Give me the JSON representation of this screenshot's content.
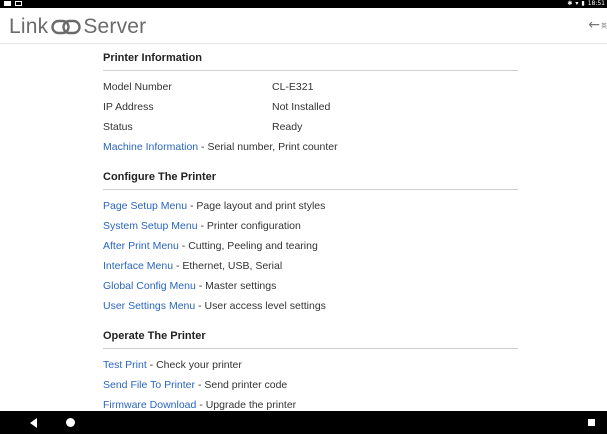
{
  "status_bar": {
    "bluetooth_icon": "bluetooth-icon",
    "wifi_icon": "wifi-icon",
    "battery_icon": "battery-icon",
    "time": "18:51"
  },
  "app": {
    "title_left": "Link",
    "title_right": "Server",
    "back_icon": "arrow-left-icon",
    "back_sub": "英"
  },
  "printer_info": {
    "title": "Printer Information",
    "rows": [
      {
        "label": "Model Number",
        "value": "CL-E321"
      },
      {
        "label": "IP Address",
        "value": "Not Installed"
      },
      {
        "label": "Status",
        "value": "Ready"
      }
    ],
    "machine_link": {
      "link": "Machine Information",
      "desc": " - Serial number, Print counter"
    }
  },
  "configure": {
    "title": "Configure The Printer",
    "items": [
      {
        "link": "Page Setup Menu",
        "desc": " - Page layout and print styles"
      },
      {
        "link": "System Setup Menu",
        "desc": " - Printer configuration"
      },
      {
        "link": "After Print Menu",
        "desc": " - Cutting, Peeling and tearing"
      },
      {
        "link": "Interface Menu",
        "desc": " - Ethernet, USB, Serial"
      },
      {
        "link": "Global Config Menu",
        "desc": " - Master settings"
      },
      {
        "link": "User Settings Menu",
        "desc": " - User access level settings"
      }
    ]
  },
  "operate": {
    "title": "Operate The Printer",
    "items": [
      {
        "link": "Test Print",
        "desc": " - Check your printer"
      },
      {
        "link": "Send File To Printer",
        "desc": " - Send printer code"
      },
      {
        "link": "Firmware Download",
        "desc": " - Upgrade the printer"
      }
    ]
  },
  "nav": {
    "back_icon": "nav-back-icon",
    "home_icon": "nav-home-icon",
    "recent_icon": "nav-recent-icon"
  },
  "colors": {
    "link": "#2a66c0",
    "logo": "#6b6b6b",
    "divider": "#cfcfcf"
  }
}
